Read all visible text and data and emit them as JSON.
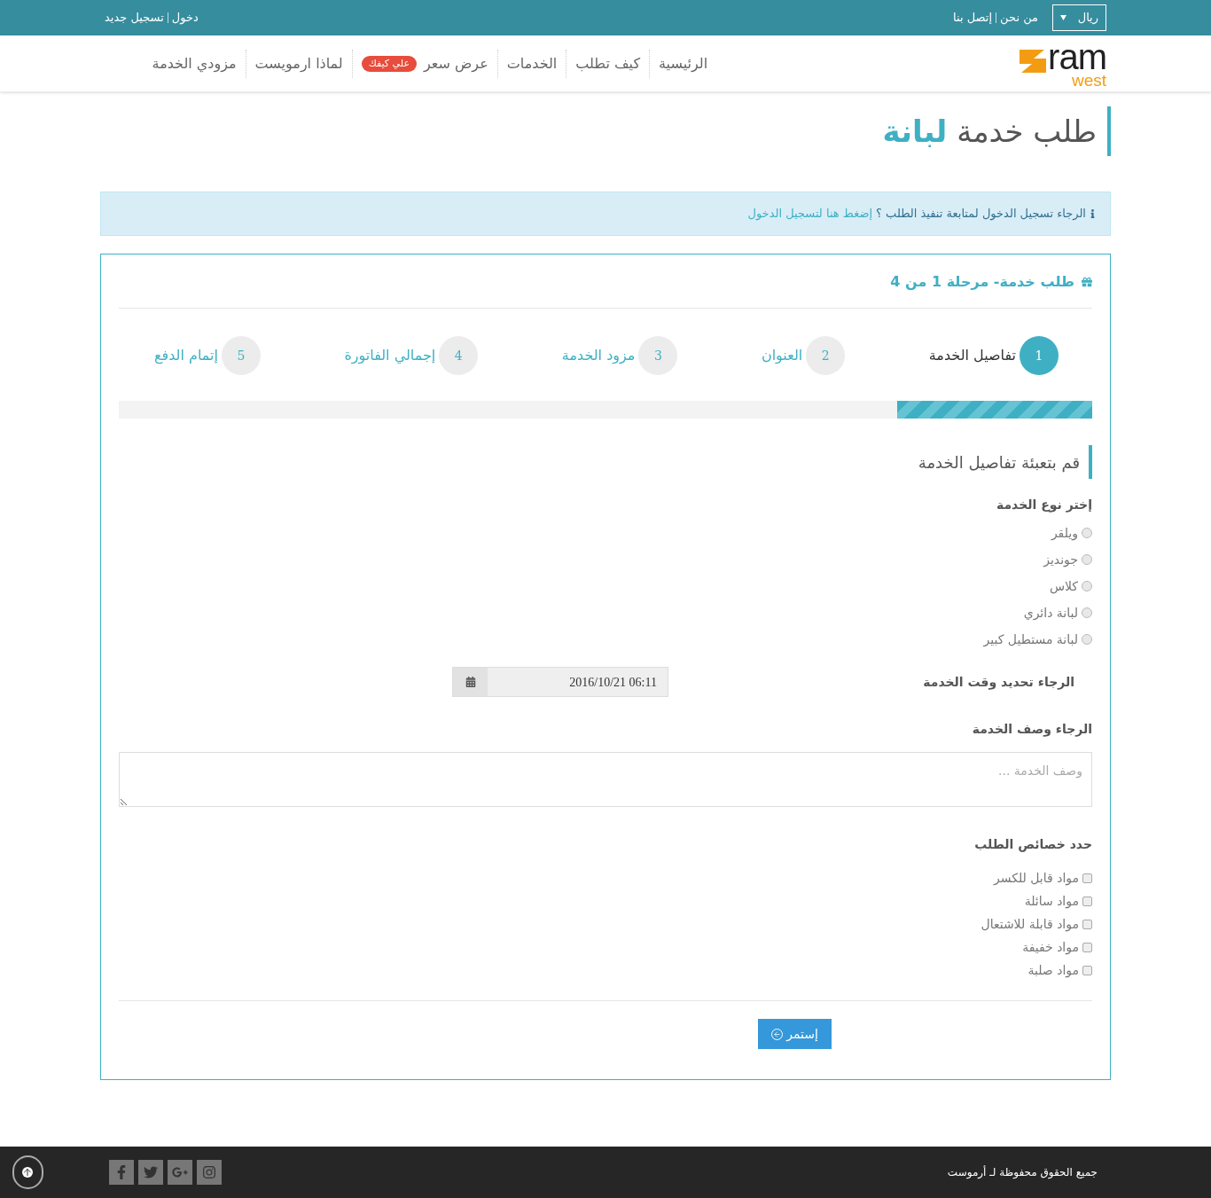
{
  "top_bar": {
    "currency": "ريال",
    "links": [
      "من نحن",
      "إتصل بنا"
    ],
    "auth": [
      "دخول",
      "تسجيل جديد"
    ]
  },
  "nav": {
    "logo": {
      "main": "ram",
      "sub": "west"
    },
    "items": [
      {
        "label": "الرئيسية",
        "selected": false
      },
      {
        "label": "كيف تطلب",
        "selected": false
      },
      {
        "label": "الخدمات",
        "selected": false
      },
      {
        "label": "عرض سعر",
        "badge": "علي كيفك",
        "selected": false
      },
      {
        "label": "لماذا ارمويست",
        "selected": false
      },
      {
        "label": "مزودي الخدمة",
        "selected": false
      }
    ]
  },
  "page_title": {
    "plain": "طلب خدمة",
    "highlight": "لبانة"
  },
  "alert": {
    "text": "الرجاء تسجيل الدخول لمتابعة تنفيذ الطلب ؟",
    "link": "إضغط هنا لتسجيل الدخول"
  },
  "panel": {
    "heading": "طلب خدمة- مرحلة 1 من 4",
    "steps": [
      {
        "number": "1",
        "label": "تفاصيل الخدمة",
        "selected": true
      },
      {
        "number": "2",
        "label": "العنوان",
        "selected": false
      },
      {
        "number": "3",
        "label": "مزود الخدمة",
        "selected": false
      },
      {
        "number": "4",
        "label": "إجمالي الفاتورة",
        "selected": false
      },
      {
        "number": "5",
        "label": "إتمام الدفع",
        "selected": false
      }
    ],
    "progress": {
      "level": 0.2
    },
    "section_title": "قم بتعبئة تفاصيل الخدمة",
    "service_type": {
      "label": "إختر نوع الخدمة",
      "options": [
        {
          "label": "ويلقر",
          "selected": false
        },
        {
          "label": "جونديز",
          "selected": false
        },
        {
          "label": "كلاس",
          "selected": false
        },
        {
          "label": "لبانة دائري",
          "selected": false
        },
        {
          "label": "لبانة مستطيل كبير",
          "selected": false
        }
      ]
    },
    "time": {
      "label": "الرجاء تحديد وقت الخدمة",
      "value": "2016/10/21 06:11"
    },
    "description": {
      "label": "الرجاء وصف الخدمة",
      "placeholder": "وصف الخدمة ..."
    },
    "features": {
      "label": "حدد خصائص الطلب",
      "options": [
        {
          "label": "مواد قابل للكسر",
          "checked": false
        },
        {
          "label": "مواد سائلة",
          "checked": false
        },
        {
          "label": "مواد قابلة للاشتعال",
          "checked": false
        },
        {
          "label": "مواد خفيفة",
          "checked": false
        },
        {
          "label": "مواد صلبة",
          "checked": false
        }
      ]
    },
    "continue_button": "إستمر"
  },
  "footer": {
    "copyright": "جميع الحقوق محفوظة لـ أرموست"
  }
}
